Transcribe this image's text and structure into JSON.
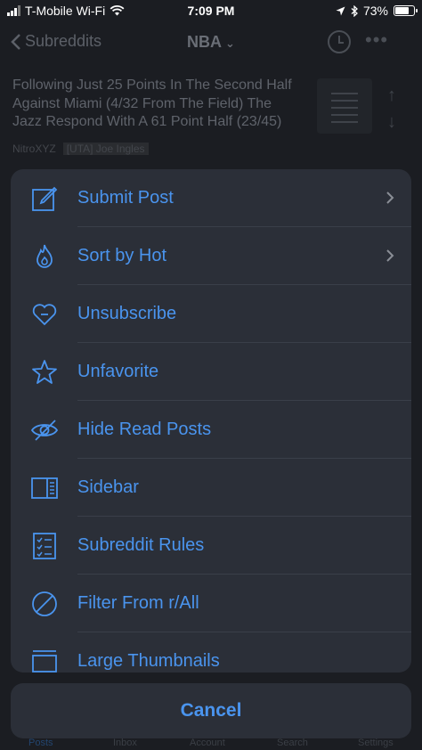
{
  "status_bar": {
    "carrier": "T-Mobile Wi-Fi",
    "time": "7:09 PM",
    "battery": "73%",
    "battery_level": 0.73
  },
  "nav": {
    "back_label": "Subreddits",
    "title": "NBA"
  },
  "background_post": {
    "title": "Following Just 25 Points In The Second Half Against Miami (4/32 From The Field) The Jazz Respond With A 61 Point Half (23/45)",
    "author": "NitroXYZ",
    "flair": "[UTA] Joe Ingles"
  },
  "sheet": {
    "items": [
      {
        "label": "Submit Post",
        "icon": "compose-icon",
        "has_chevron": true
      },
      {
        "label": "Sort by Hot",
        "icon": "flame-icon",
        "has_chevron": true
      },
      {
        "label": "Unsubscribe",
        "icon": "heart-minus-icon",
        "has_chevron": false
      },
      {
        "label": "Unfavorite",
        "icon": "star-icon",
        "has_chevron": false
      },
      {
        "label": "Hide Read Posts",
        "icon": "eye-slash-icon",
        "has_chevron": false
      },
      {
        "label": "Sidebar",
        "icon": "sidebar-icon",
        "has_chevron": false
      },
      {
        "label": "Subreddit Rules",
        "icon": "checklist-icon",
        "has_chevron": false
      },
      {
        "label": "Filter From r/All",
        "icon": "no-entry-icon",
        "has_chevron": false
      },
      {
        "label": "Large Thumbnails",
        "icon": "thumbnail-icon",
        "has_chevron": false
      }
    ],
    "cancel_label": "Cancel"
  },
  "tab_bar": {
    "tabs": [
      "Posts",
      "Inbox",
      "Account",
      "Search",
      "Settings"
    ]
  },
  "colors": {
    "accent": "#4a94ee",
    "sheet_bg": "#2b2f38",
    "page_bg": "#1b1d22"
  }
}
